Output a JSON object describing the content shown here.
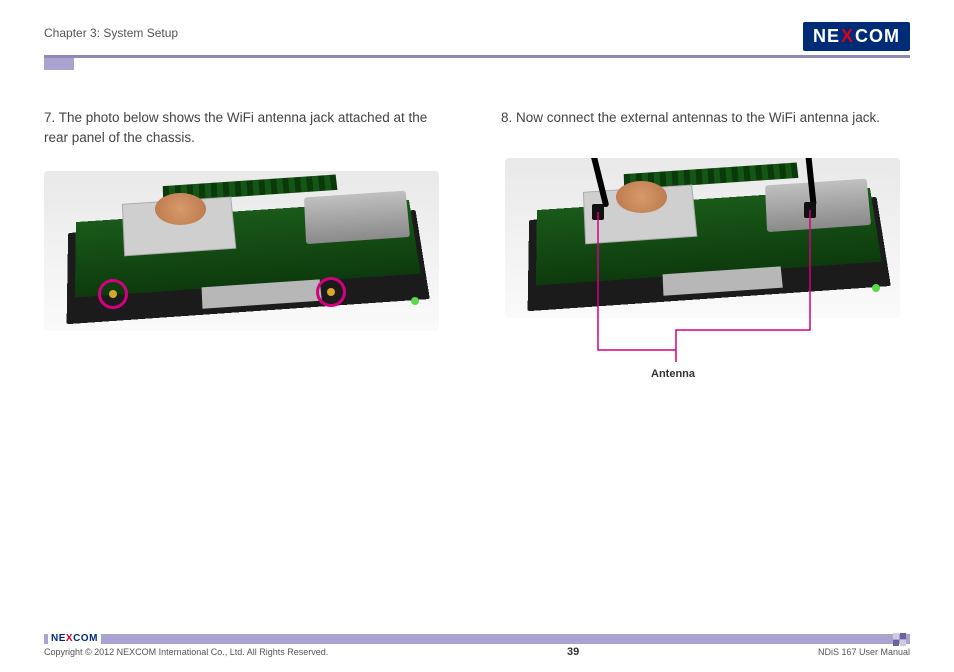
{
  "header": {
    "chapter": "Chapter 3: System Setup",
    "brand_left": "NE",
    "brand_x": "X",
    "brand_right": "COM"
  },
  "steps": {
    "s7": "7.  The photo below shows the WiFi antenna jack attached at the rear panel of the chassis.",
    "s8": "8.  Now connect the external antennas to the WiFi antenna jack."
  },
  "callout": {
    "antenna": "Antenna"
  },
  "footer": {
    "brand_left": "NE",
    "brand_x": "X",
    "brand_right": "COM",
    "copyright": "Copyright © 2012 NEXCOM International Co., Ltd. All Rights Reserved.",
    "page": "39",
    "doc": "NDiS 167 User Manual"
  }
}
